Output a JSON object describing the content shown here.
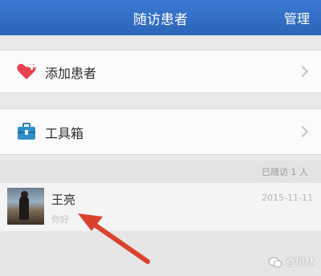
{
  "header": {
    "title": "随访患者",
    "action_label": "管理",
    "background_color": "#2f6bc2"
  },
  "menu": [
    {
      "label": "添加患者",
      "icon": "heart-plus-icon",
      "icon_color": "#e8414d"
    },
    {
      "label": "工具箱",
      "icon": "toolbox-icon",
      "icon_color": "#2f7fb5"
    }
  ],
  "visited": {
    "count_label": "已随访 1 人"
  },
  "patients": [
    {
      "name": "王亮",
      "date": "2015-11-11",
      "message": "你好"
    }
  ],
  "annotation": {
    "arrow_color": "#d9432e"
  },
  "watermark": {
    "text": "香树林"
  }
}
